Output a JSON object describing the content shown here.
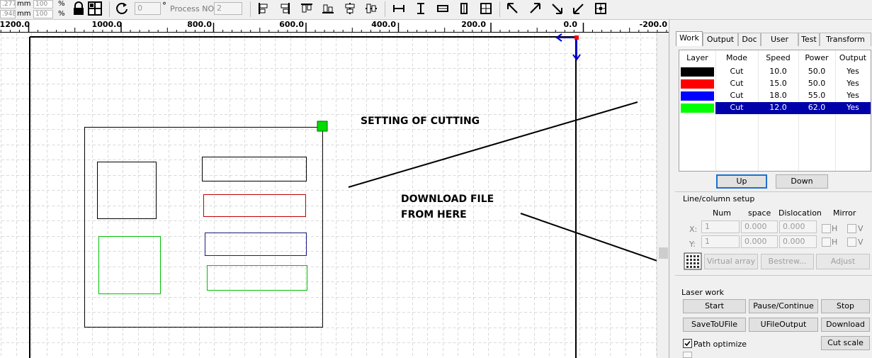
{
  "toolbar": {
    "pos_x": ".277",
    "pos_y": ".948",
    "unit_x": "mm",
    "unit_y": "mm",
    "scale_x": "100",
    "scale_y": "100",
    "pct_x": "%",
    "pct_y": "%",
    "rotate_value": "0",
    "rotate_unit": "°",
    "process_label": "Process NO:",
    "process_value": "2"
  },
  "ruler": {
    "ticks": [
      "1200.0",
      "1000.0",
      "800.0",
      "600.0",
      "400.0",
      "200.0",
      "0.0",
      "-200.0"
    ]
  },
  "canvas": {
    "annotation_cutting": "SETTING OF CUTTING",
    "annotation_download_1": "DOWNLOAD FILE",
    "annotation_download_2": "FROM HERE",
    "colors": {
      "black": "#000000",
      "red": "#c00000",
      "blue": "#1a1a80",
      "green": "#00c000",
      "handle": "#00dd00"
    }
  },
  "tabs": [
    "Work",
    "Output",
    "Doc",
    "User",
    "Test",
    "Transform"
  ],
  "layer_table": {
    "headers": [
      "Layer",
      "Mode",
      "Speed",
      "Power",
      "Output"
    ],
    "rows": [
      {
        "color": "#000000",
        "mode": "Cut",
        "speed": "10.0",
        "power": "50.0",
        "output": "Yes"
      },
      {
        "color": "#ff0000",
        "mode": "Cut",
        "speed": "15.0",
        "power": "50.0",
        "output": "Yes"
      },
      {
        "color": "#0000ff",
        "mode": "Cut",
        "speed": "18.0",
        "power": "55.0",
        "output": "Yes"
      },
      {
        "color": "#00ff00",
        "mode": "Cut",
        "speed": "12.0",
        "power": "62.0",
        "output": "Yes"
      }
    ],
    "selected_row": 3
  },
  "buttons": {
    "up": "Up",
    "down": "Down",
    "virtual_array": "Virtual array",
    "bestrew": "Bestrew...",
    "adjust": "Adjust",
    "start": "Start",
    "pause": "Pause/Continue",
    "stop": "Stop",
    "save_to_ufile": "SaveToUFile",
    "ufile_output": "UFileOutput",
    "download": "Download",
    "cut_scale": "Cut scale"
  },
  "array_setup": {
    "title": "Line/column setup",
    "col_num": "Num",
    "col_space": "space",
    "col_dislocation": "Dislocation",
    "col_mirror": "Mirror",
    "x_label": "X:",
    "y_label": "Y:",
    "x_num": "1",
    "x_space": "0.000",
    "x_disloc": "0.000",
    "y_num": "1",
    "y_space": "0.000",
    "y_disloc": "0.000",
    "h_label": "H",
    "v_label": "V"
  },
  "laser_work": {
    "title": "Laser work",
    "path_optimize": "Path optimize",
    "path_optimize_checked": true
  }
}
